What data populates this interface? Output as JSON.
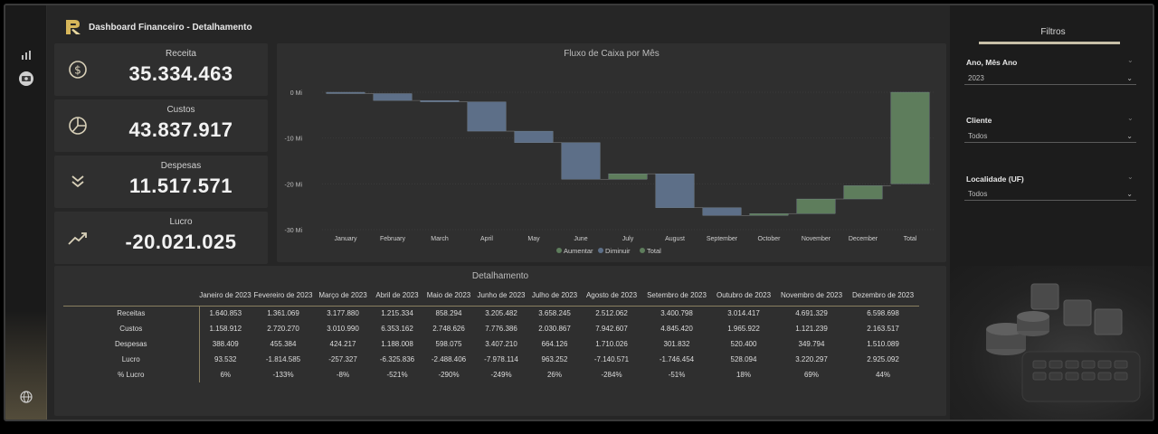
{
  "header": {
    "title": "Dashboard Financeiro - Detalhamento"
  },
  "kpis": [
    {
      "label": "Receita",
      "value": "35.334.463",
      "icon": "dollar-coin-icon"
    },
    {
      "label": "Custos",
      "value": "43.837.917",
      "icon": "pie-chart-icon"
    },
    {
      "label": "Despesas",
      "value": "11.517.571",
      "icon": "double-chevron-down-icon"
    },
    {
      "label": "Lucro",
      "value": "-20.021.025",
      "icon": "trend-up-icon"
    }
  ],
  "chart_data": {
    "type": "waterfall",
    "title": "Fluxo de Caixa por Mês",
    "categories": [
      "January",
      "February",
      "March",
      "April",
      "May",
      "June",
      "July",
      "August",
      "September",
      "October",
      "November",
      "December",
      "Total"
    ],
    "values": [
      -0.3,
      -1.5,
      -0.3,
      -6.4,
      -2.5,
      -8.0,
      1.2,
      -7.4,
      -1.7,
      0.4,
      3.2,
      2.9,
      -20.0
    ],
    "is_total": [
      false,
      false,
      false,
      false,
      false,
      false,
      false,
      false,
      false,
      false,
      false,
      false,
      true
    ],
    "yticks": [
      "0 Mi",
      "-10 Mi",
      "-20 Mi",
      "-30 Mi"
    ],
    "ylim": [
      -30,
      0
    ],
    "unit": "Mi",
    "legend": [
      {
        "name": "Aumentar",
        "color": "#5e7d5c"
      },
      {
        "name": "Diminuir",
        "color": "#5d6f88"
      },
      {
        "name": "Total",
        "color": "#5e7d5c"
      }
    ],
    "legend_position": "bottom",
    "colors": {
      "increase": "#5e7d5c",
      "decrease": "#5d6f88",
      "total": "#5e7d5c"
    }
  },
  "table": {
    "title": "Detalhamento",
    "columns": [
      "Janeiro de 2023",
      "Fevereiro de 2023",
      "Março de 2023",
      "Abril de 2023",
      "Maio de 2023",
      "Junho de 2023",
      "Julho de 2023",
      "Agosto de 2023",
      "Setembro de 2023",
      "Outubro de 2023",
      "Novembro de 2023",
      "Dezembro de 2023"
    ],
    "rows": [
      {
        "label": "Receitas",
        "values": [
          "1.640.853",
          "1.361.069",
          "3.177.880",
          "1.215.334",
          "858.294",
          "3.205.482",
          "3.658.245",
          "2.512.062",
          "3.400.798",
          "3.014.417",
          "4.691.329",
          "6.598.698"
        ]
      },
      {
        "label": "Custos",
        "values": [
          "1.158.912",
          "2.720.270",
          "3.010.990",
          "6.353.162",
          "2.748.626",
          "7.776.386",
          "2.030.867",
          "7.942.607",
          "4.845.420",
          "1.965.922",
          "1.121.239",
          "2.163.517"
        ]
      },
      {
        "label": "Despesas",
        "values": [
          "388.409",
          "455.384",
          "424.217",
          "1.188.008",
          "598.075",
          "3.407.210",
          "664.126",
          "1.710.026",
          "301.832",
          "520.400",
          "349.794",
          "1.510.089"
        ]
      },
      {
        "label": "Lucro",
        "values": [
          "93.532",
          "-1.814.585",
          "-257.327",
          "-6.325.836",
          "-2.488.406",
          "-7.978.114",
          "963.252",
          "-7.140.571",
          "-1.746.454",
          "528.094",
          "3.220.297",
          "2.925.092"
        ]
      },
      {
        "label": "% Lucro",
        "values": [
          "6%",
          "-133%",
          "-8%",
          "-521%",
          "-290%",
          "-249%",
          "26%",
          "-284%",
          "-51%",
          "18%",
          "69%",
          "44%"
        ]
      }
    ]
  },
  "filters": {
    "title": "Filtros",
    "items": [
      {
        "label": "Ano, Mês Ano",
        "value": "2023"
      },
      {
        "label": "Cliente",
        "value": "Todos"
      },
      {
        "label": "Localidade (UF)",
        "value": "Todos"
      }
    ]
  },
  "rail_icons": [
    "bar-chart-icon",
    "money-icon",
    "globe-icon"
  ]
}
